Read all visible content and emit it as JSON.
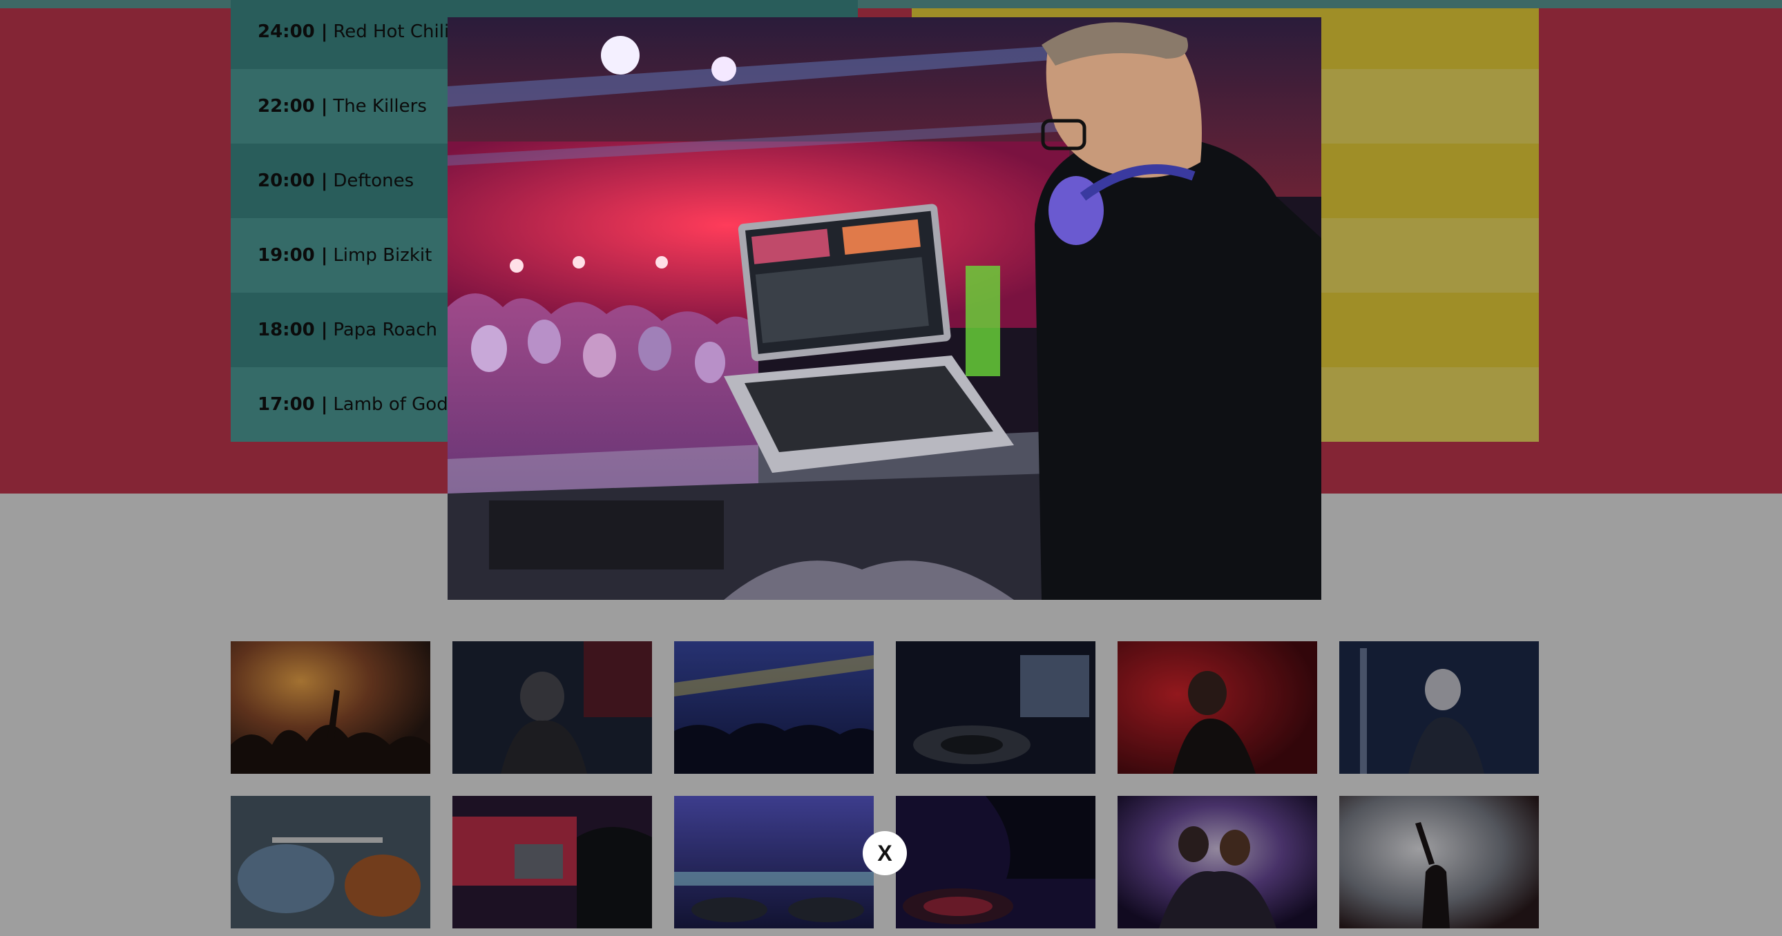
{
  "schedule": [
    {
      "time": "24:00 |",
      "artist": "Red Hot Chili Peppers"
    },
    {
      "time": "22:00 |",
      "artist": "The Killers"
    },
    {
      "time": "20:00 |",
      "artist": "Deftones"
    },
    {
      "time": "19:00 |",
      "artist": "Limp Bizkit"
    },
    {
      "time": "18:00 |",
      "artist": "Papa Roach"
    },
    {
      "time": "17:00 |",
      "artist": "Lamb of God"
    }
  ],
  "lightbox": {
    "close_label": "X"
  },
  "colors": {
    "accent_red": "#c3374e",
    "teal": "#3d8a86",
    "yellow": "#ead23a"
  }
}
